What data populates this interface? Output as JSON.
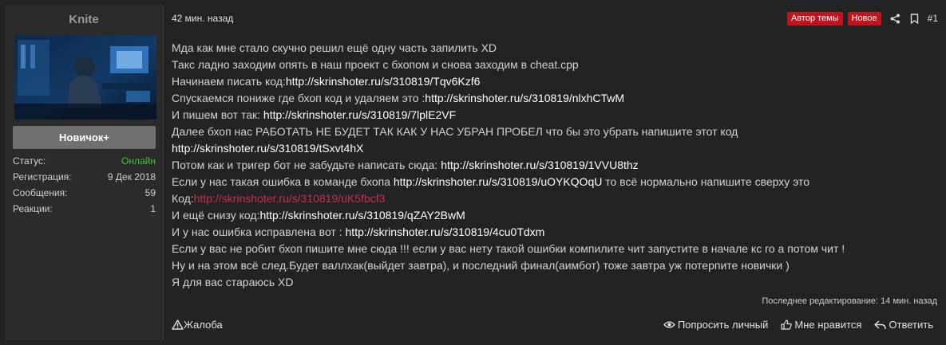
{
  "sidebar": {
    "username": "Knite",
    "rank": "Новичок+",
    "stats": [
      {
        "key": "Статус:",
        "value": "Онлайн"
      },
      {
        "key": "Регистрация:",
        "value": "9 Дек 2018"
      },
      {
        "key": "Сообщения:",
        "value": "59"
      },
      {
        "key": "Реакции:",
        "value": "1"
      }
    ]
  },
  "header": {
    "time": "42 мин. назад",
    "badge_author": "Автор темы",
    "badge_new": "Новое",
    "post_number": "#1"
  },
  "body": {
    "lines": [
      {
        "text": "Мда как мне стало скучно решил ещё одну часть запилить XD",
        "link": ""
      },
      {
        "text": "Такс ладно заходим опять в наш проект с бхопом и снова заходим в cheat.cpp",
        "link": ""
      },
      {
        "text": "Начинаем писать код:",
        "link": "http://skrinshoter.ru/s/310819/Tqv6Kzf6"
      },
      {
        "text": "Спускаемся пониже где бхоп код и удаляем это :",
        "link": "http://skrinshoter.ru/s/310819/nlxhCTwM"
      },
      {
        "text": "И пишем вот так: ",
        "link": "http://skrinshoter.ru/s/310819/7lplE2VF"
      },
      {
        "text": "Далее бхоп нас РАБОТАТЬ НЕ БУДЕТ ТАК КАК У НАС УБРАН ПРОБЕЛ что бы это убрать напишите этот код",
        "link": ""
      },
      {
        "text": "",
        "link": "http://skrinshoter.ru/s/310819/tSxvt4hX"
      },
      {
        "text": "Потом как и тригер бот не забудьте написать сюда: ",
        "link": "http://skrinshoter.ru/s/310819/1VVU8thz"
      },
      {
        "text": "Если у нас такая ошибка в команде бхопа ",
        "link": "http://skrinshoter.ru/s/310819/uOYKQOqU",
        "after": " то всё нормально напишите сверху это"
      },
      {
        "text": "Код:",
        "link_red": "http://skrinshoter.ru/s/310819/uK5fbcf3"
      },
      {
        "text": "И ещё снизу код:",
        "link": "http://skrinshoter.ru/s/310819/qZAY2BwM"
      },
      {
        "text": "И у нас ошибка исправлена вот : ",
        "link": "http://skrinshoter.ru/s/310819/4cu0Tdxm"
      },
      {
        "text": "Если у вас не робит бхоп пишите мне сюда !!! если у вас нету такой ошибки компилите чит запустите в начале кс го а потом чит !",
        "link": ""
      },
      {
        "text": "Ну и на этом всё след.Будет валлхак(выйдет завтра), и последний финал(аимбот) тоже завтра уж потерпите новички )",
        "link": ""
      },
      {
        "text": "Я для вас стараюсь XD",
        "link": ""
      }
    ],
    "edit_note": "Последнее редактирование: 14 мин. назад"
  },
  "footer": {
    "report": "Жалоба",
    "ask": "Попросить личный",
    "like": "Мне нравится",
    "reply": "Ответить"
  },
  "colors": {
    "badge_red": "#c0151e",
    "online_green": "#3ec43e",
    "link_red": "#c4304a"
  }
}
